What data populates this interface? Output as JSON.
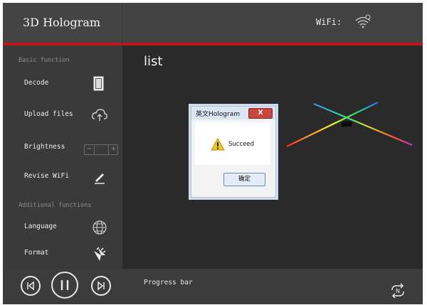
{
  "app": {
    "title": "3D  Hologram"
  },
  "topbar": {
    "wifi_label": "WiFi:"
  },
  "sidebar": {
    "section_basic": "Basic function",
    "section_additional": "Additional functions",
    "items": [
      {
        "label": "Decode",
        "icon": "document-icon"
      },
      {
        "label": "Upload files",
        "icon": "cloud-upload-icon"
      },
      {
        "label": "Brightness",
        "icon": "brightness-stepper"
      },
      {
        "label": "Revise WiFi",
        "icon": "pencil-icon"
      },
      {
        "label": "Language",
        "icon": "globe-icon"
      },
      {
        "label": "Format",
        "icon": "format-icon"
      }
    ],
    "brightness": {
      "minus": "−",
      "plus": "+"
    }
  },
  "main": {
    "list_title": "list"
  },
  "bottom": {
    "progress_label": "Progress bar"
  },
  "dialog": {
    "title": "英文Hologram",
    "close": "X",
    "message": "Succeed",
    "ok": "确定"
  },
  "colors": {
    "accent": "#c0161a",
    "panel": "#3a3a3a",
    "content": "#2a2a2a"
  }
}
